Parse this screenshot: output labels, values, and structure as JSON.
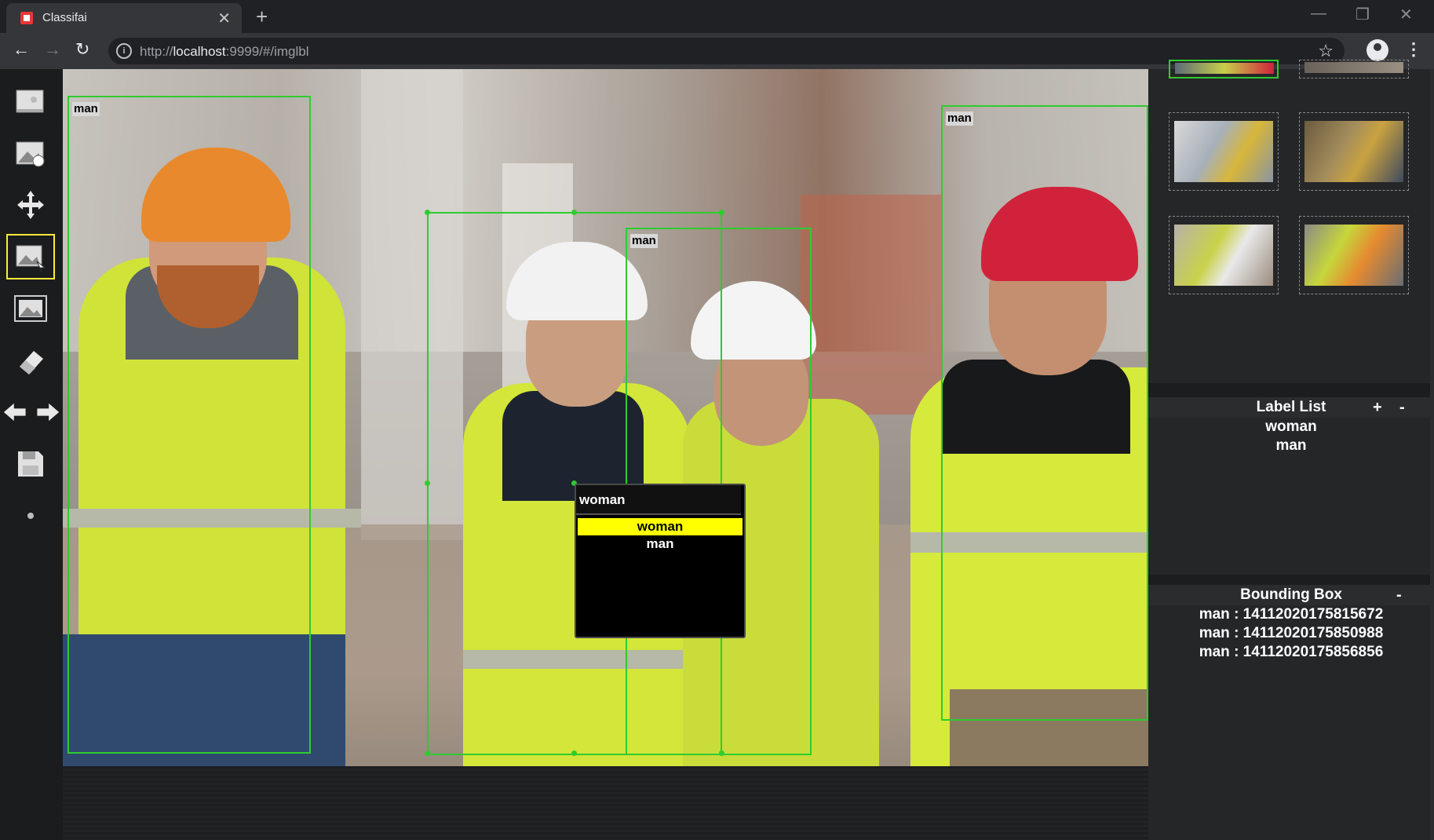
{
  "browser": {
    "tab_title": "Classifai",
    "url_prefix": "http://",
    "url_host": "localhost",
    "url_rest": ":9999/#/imglbl"
  },
  "toolbar_tools": [
    {
      "name": "open-folder-icon"
    },
    {
      "name": "add-image-icon"
    },
    {
      "name": "move-icon"
    },
    {
      "name": "bounding-box-tool-icon",
      "active": true
    },
    {
      "name": "polygon-image-icon"
    },
    {
      "name": "eraser-icon"
    },
    {
      "name": "prev-next-arrows-icon"
    },
    {
      "name": "save-icon"
    },
    {
      "name": "dot-icon"
    }
  ],
  "annotations": [
    {
      "label": "man"
    },
    {
      "label": "man"
    },
    {
      "label": "man"
    },
    {
      "label": "woman"
    }
  ],
  "label_popup": {
    "input_value": "woman",
    "options": [
      "woman",
      "man"
    ],
    "highlight_color": "#ffff00"
  },
  "label_list": {
    "title": "Label List",
    "add": "+",
    "remove": "-",
    "items": [
      "woman",
      "man"
    ]
  },
  "bounding_box_panel": {
    "title": "Bounding Box",
    "remove": "-",
    "items": [
      "man : 14112020175815672",
      "man : 14112020175850988",
      "man : 14112020175856856"
    ]
  },
  "colors": {
    "bbox": "#2ecc2e",
    "active_tool": "#ffeb3b"
  }
}
